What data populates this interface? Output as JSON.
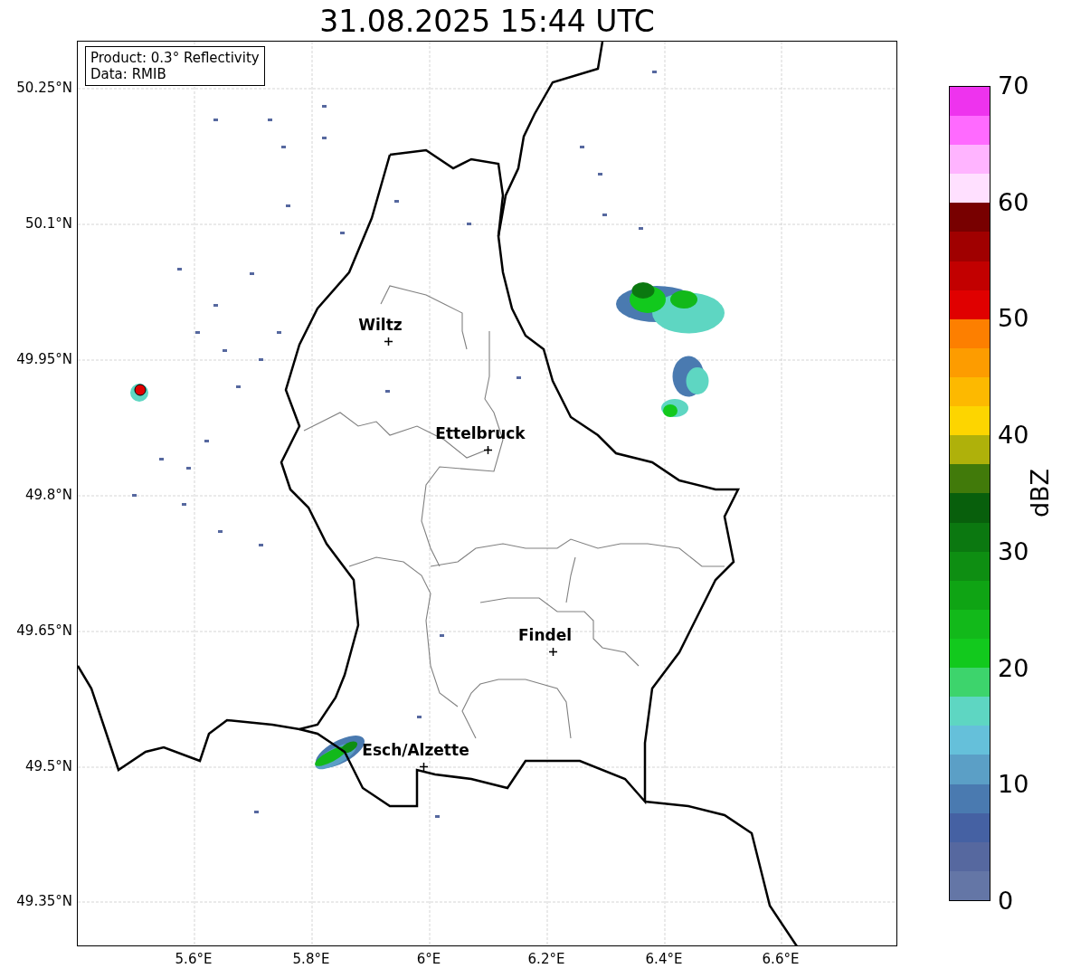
{
  "title": "31.08.2025 15:44 UTC",
  "info_box": {
    "lines": [
      "Product: 0.3° Reflectivity",
      "Data: RMIB"
    ]
  },
  "x_ticks": [
    "5.6°E",
    "5.8°E",
    "6°E",
    "6.2°E",
    "6.4°E",
    "6.6°E"
  ],
  "y_ticks": [
    "50.25°N",
    "50.1°N",
    "49.95°N",
    "49.8°N",
    "49.65°N",
    "49.5°N",
    "49.35°N"
  ],
  "cities": [
    {
      "name": "Wiltz"
    },
    {
      "name": "Ettelbruck"
    },
    {
      "name": "Findel"
    },
    {
      "name": "Esch/Alzette"
    }
  ],
  "colorbar": {
    "label": "dBZ",
    "ticks": [
      "70",
      "60",
      "50",
      "40",
      "30",
      "20",
      "10",
      "0"
    ],
    "segments": [
      {
        "color": "#6476a6"
      },
      {
        "color": "#56689f"
      },
      {
        "color": "#4561a3"
      },
      {
        "color": "#4a7ab0"
      },
      {
        "color": "#5b9fc6"
      },
      {
        "color": "#65c0da"
      },
      {
        "color": "#5ed6c2"
      },
      {
        "color": "#3dd46c"
      },
      {
        "color": "#12c91d"
      },
      {
        "color": "#12b91a"
      },
      {
        "color": "#0fa414"
      },
      {
        "color": "#0e8e12"
      },
      {
        "color": "#0b7810"
      },
      {
        "color": "#085f0c"
      },
      {
        "color": "#417a0a"
      },
      {
        "color": "#afb10a"
      },
      {
        "color": "#fdd500"
      },
      {
        "color": "#fdb900"
      },
      {
        "color": "#fd9c00"
      },
      {
        "color": "#fd7f00"
      },
      {
        "color": "#e00000"
      },
      {
        "color": "#c20000"
      },
      {
        "color": "#a00000"
      },
      {
        "color": "#780000"
      },
      {
        "color": "#ffe0ff"
      },
      {
        "color": "#ffb4ff"
      },
      {
        "color": "#ff6aff"
      },
      {
        "color": "#ee33ee"
      }
    ]
  }
}
